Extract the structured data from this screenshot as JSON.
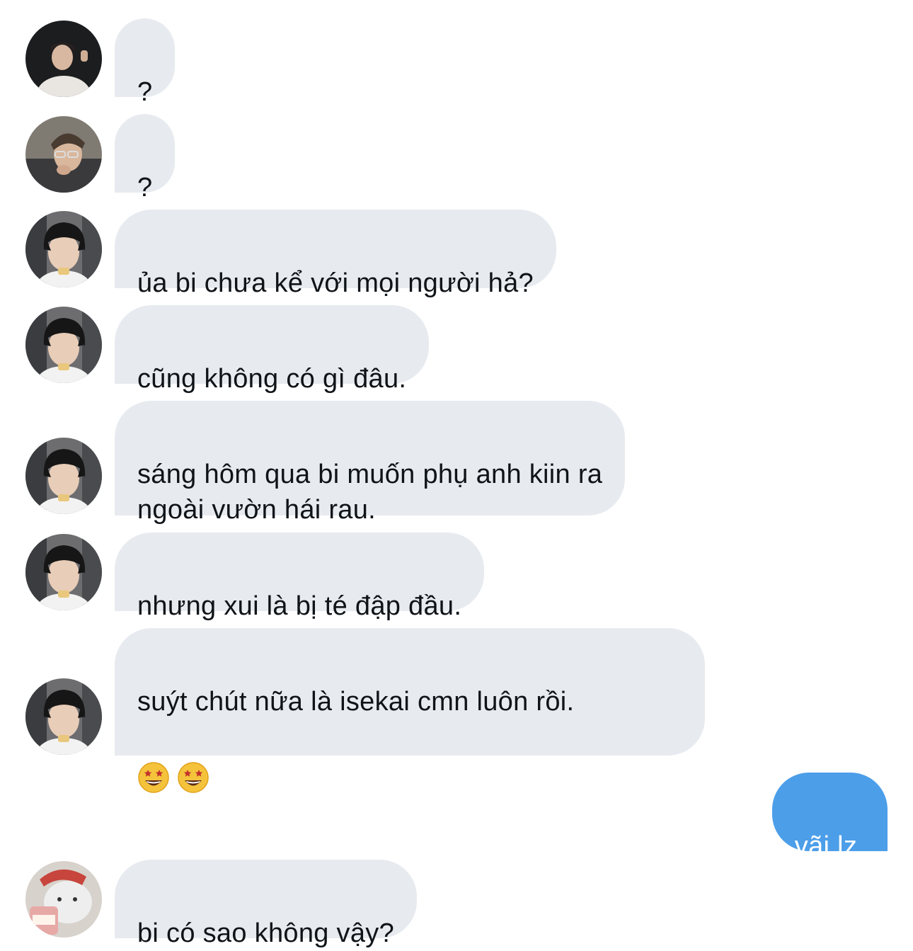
{
  "messages": [
    {
      "text": "?"
    },
    {
      "text": "?"
    },
    {
      "text": "ủa bi chưa kể với mọi người hả?"
    },
    {
      "text": "cũng không có gì đâu."
    },
    {
      "text": "sáng hôm qua bi muốn phụ anh kiin ra\nngoài vườn hái rau."
    },
    {
      "text": "nhưng xui là bị té đập đầu."
    },
    {
      "text": "suýt chút nữa là isekai cmn luôn rồi.",
      "emojis": [
        "star-struck-emoji",
        "star-struck-emoji"
      ]
    },
    {
      "text": "vãi lz."
    },
    {
      "text": "bi có sao không vậy?"
    }
  ],
  "colors": {
    "incoming_bubble": "#e7ebef",
    "outgoing_bubble": "#4c9ee9",
    "incoming_text": "#0f1419",
    "outgoing_text": "#ffffff"
  }
}
